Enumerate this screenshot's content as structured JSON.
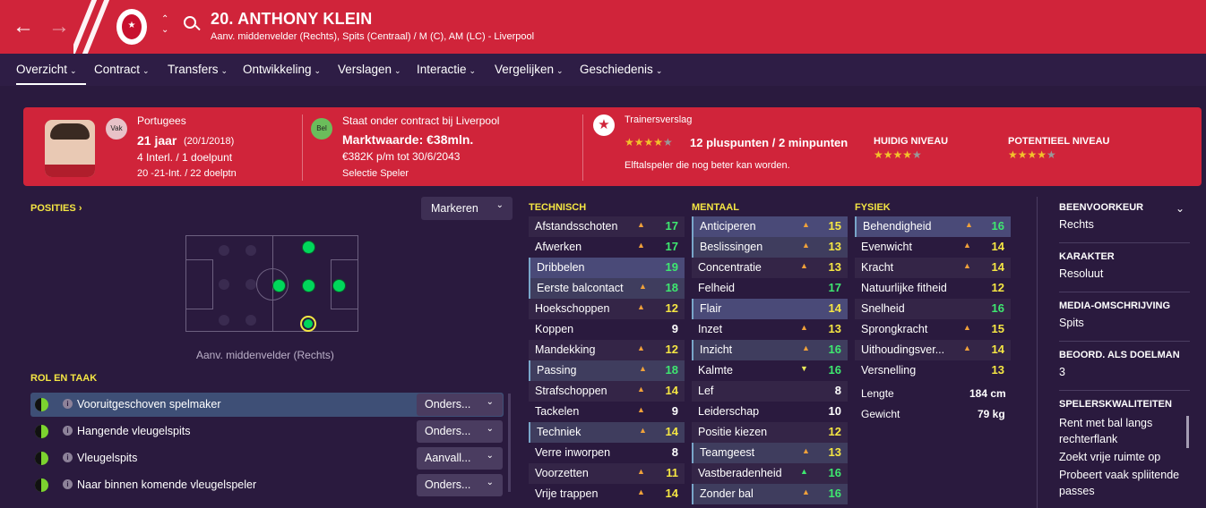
{
  "header": {
    "back_icon": "←",
    "forward_icon": "→",
    "player_title": "20. ANTHONY KLEIN",
    "player_subtitle": "Aanv. middenvelder (Rechts), Spits (Centraal) / M (C), AM (LC) - Liverpool",
    "club_crest_text": "★",
    "colors": {
      "brand": "#d0243a",
      "bg": "#2a1a3e"
    }
  },
  "menu": [
    {
      "label": "Overzicht",
      "active": true
    },
    {
      "label": "Contract"
    },
    {
      "label": "Transfers"
    },
    {
      "label": "Ontwikkeling"
    },
    {
      "label": "Verslagen"
    },
    {
      "label": "Interactie"
    },
    {
      "label": "Vergelijken"
    },
    {
      "label": "Geschiedenis"
    }
  ],
  "profile": {
    "nat_badge": "Vak",
    "nationality": "Portugees",
    "age": "21 jaar",
    "dob": "(20/1/2018)",
    "intl": "4 Interl. / 1 doelpunt",
    "u21": "20 -21-Int. / 22 doelptn",
    "contract_badge": "Bel",
    "contract": "Staat onder contract bij Liverpool",
    "value": "Marktwaarde: €38mln.",
    "wage": "€382K p/m tot 30/6/2043",
    "selection": "Selectie Speler",
    "report_title": "Trainersverslag",
    "report_points": "12 pluspunten / 2 minpunten",
    "report_stars": 4,
    "report_desc": "Elftalspeler die nog beter kan worden.",
    "current_label": "HUIDIG NIVEAU",
    "current_stars": 4,
    "potential_label": "POTENTIEEL NIVEAU",
    "potential_stars": 4
  },
  "positions": {
    "title": "POSITIES",
    "title_icon": "chevron-right",
    "mark_label": "Markeren",
    "position_caption": "Aanv. middenvelder (Rechts)"
  },
  "roles": {
    "title": "ROL EN TAAK",
    "items": [
      {
        "name": "Vooruitgeschoven spelmaker",
        "duty": "Onders...",
        "active": true
      },
      {
        "name": "Hangende vleugelspits",
        "duty": "Onders..."
      },
      {
        "name": "Vleugelspits",
        "duty": "Aanvall..."
      },
      {
        "name": "Naar binnen komende vleugelspeler",
        "duty": "Onders..."
      }
    ]
  },
  "attributes": {
    "technical_title": "TECHNISCH",
    "mental_title": "MENTAAL",
    "physical_title": "FYSIEK",
    "technical": [
      {
        "n": "Afstandsschoten",
        "v": "17",
        "c": "g",
        "arrow": "▲"
      },
      {
        "n": "Afwerken",
        "v": "17",
        "c": "g",
        "arrow": "▲"
      },
      {
        "n": "Dribbelen",
        "v": "19",
        "c": "g",
        "arrow": "",
        "hl": true
      },
      {
        "n": "Eerste balcontact",
        "v": "18",
        "c": "g",
        "arrow": "▲",
        "hl2": true
      },
      {
        "n": "Hoekschoppen",
        "v": "12",
        "c": "y",
        "arrow": "▲"
      },
      {
        "n": "Koppen",
        "v": "9",
        "c": "w",
        "arrow": ""
      },
      {
        "n": "Mandekking",
        "v": "12",
        "c": "y",
        "arrow": "▲"
      },
      {
        "n": "Passing",
        "v": "18",
        "c": "g",
        "arrow": "▲",
        "hl2": true
      },
      {
        "n": "Strafschoppen",
        "v": "14",
        "c": "y",
        "arrow": "▲"
      },
      {
        "n": "Tackelen",
        "v": "9",
        "c": "w",
        "arrow": "▲"
      },
      {
        "n": "Techniek",
        "v": "14",
        "c": "y",
        "arrow": "▲",
        "hl2": true
      },
      {
        "n": "Verre inworpen",
        "v": "8",
        "c": "w",
        "arrow": ""
      },
      {
        "n": "Voorzetten",
        "v": "11",
        "c": "y",
        "arrow": "▲"
      },
      {
        "n": "Vrije trappen",
        "v": "14",
        "c": "y",
        "arrow": "▲"
      }
    ],
    "mental": [
      {
        "n": "Anticiperen",
        "v": "15",
        "c": "y",
        "arrow": "▲",
        "hl": true
      },
      {
        "n": "Beslissingen",
        "v": "13",
        "c": "y",
        "arrow": "▲",
        "hl2": true
      },
      {
        "n": "Concentratie",
        "v": "13",
        "c": "y",
        "arrow": "▲"
      },
      {
        "n": "Felheid",
        "v": "17",
        "c": "g",
        "arrow": ""
      },
      {
        "n": "Flair",
        "v": "14",
        "c": "y",
        "arrow": "",
        "hl": true
      },
      {
        "n": "Inzet",
        "v": "13",
        "c": "y",
        "arrow": "▲"
      },
      {
        "n": "Inzicht",
        "v": "16",
        "c": "g",
        "arrow": "▲",
        "hl2": true
      },
      {
        "n": "Kalmte",
        "v": "16",
        "c": "g",
        "arrow": "▼"
      },
      {
        "n": "Lef",
        "v": "8",
        "c": "w",
        "arrow": ""
      },
      {
        "n": "Leiderschap",
        "v": "10",
        "c": "w",
        "arrow": ""
      },
      {
        "n": "Positie kiezen",
        "v": "12",
        "c": "y",
        "arrow": ""
      },
      {
        "n": "Teamgeest",
        "v": "13",
        "c": "y",
        "arrow": "▲",
        "hl2": true
      },
      {
        "n": "Vastberadenheid",
        "v": "16",
        "c": "g",
        "arrow": "▲"
      },
      {
        "n": "Zonder bal",
        "v": "16",
        "c": "g",
        "arrow": "▲",
        "hl2": true
      }
    ],
    "physical": [
      {
        "n": "Behendigheid",
        "v": "16",
        "c": "g",
        "arrow": "▲",
        "hl": true
      },
      {
        "n": "Evenwicht",
        "v": "14",
        "c": "y",
        "arrow": "▲"
      },
      {
        "n": "Kracht",
        "v": "14",
        "c": "y",
        "arrow": "▲"
      },
      {
        "n": "Natuurlijke fitheid",
        "v": "12",
        "c": "y",
        "arrow": ""
      },
      {
        "n": "Snelheid",
        "v": "16",
        "c": "g",
        "arrow": ""
      },
      {
        "n": "Sprongkracht",
        "v": "15",
        "c": "y",
        "arrow": "▲"
      },
      {
        "n": "Uithoudingsver...",
        "v": "14",
        "c": "y",
        "arrow": "▲"
      },
      {
        "n": "Versnelling",
        "v": "13",
        "c": "y",
        "arrow": ""
      }
    ],
    "height_label": "Lengte",
    "height": "184 cm",
    "weight_label": "Gewicht",
    "weight": "79 kg"
  },
  "info": [
    {
      "h": "BEENVOORKEUR",
      "v": "Rechts",
      "chev": true
    },
    {
      "h": "KARAKTER",
      "v": "Resoluut"
    },
    {
      "h": "MEDIA-OMSCHRIJVING",
      "v": "Spits"
    },
    {
      "h": "BEOORD. ALS DOELMAN",
      "v": "3"
    },
    {
      "h": "SPELERSKWALITEITEN",
      "v": "Rent met bal langs rechterflank"
    }
  ],
  "traits_more": [
    "Zoekt vrije ruimte op",
    "Probeert vaak spliitende passes"
  ]
}
